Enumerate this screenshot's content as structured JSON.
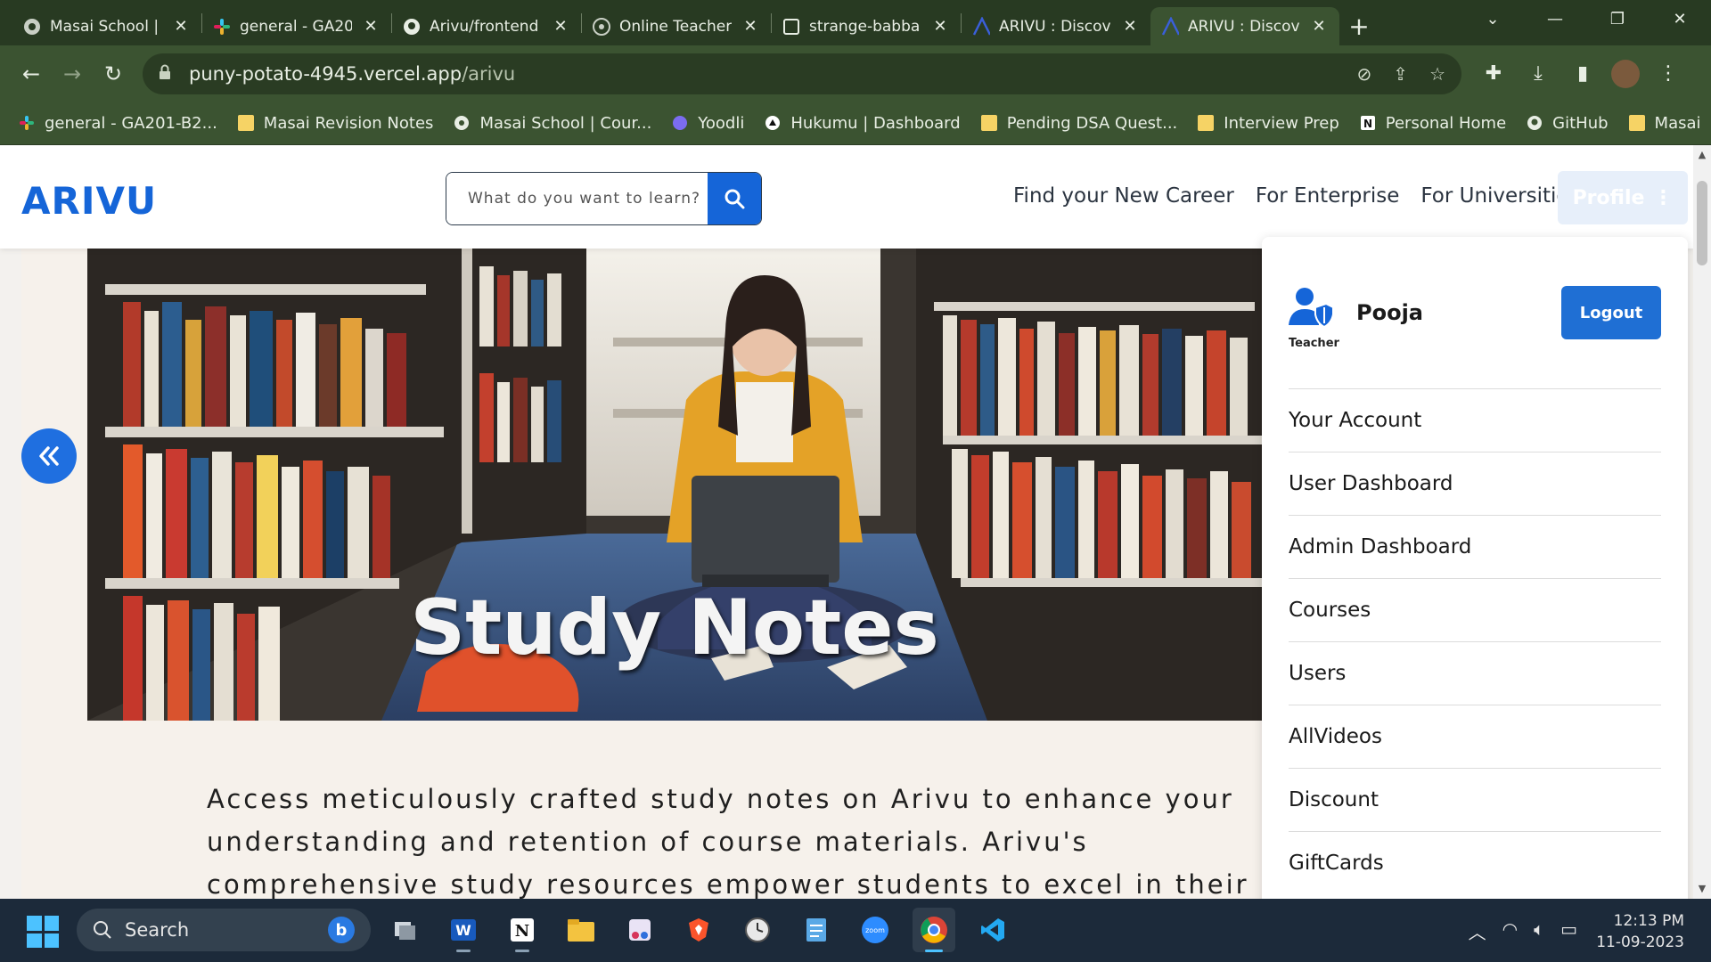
{
  "browser": {
    "tabs": [
      {
        "title": "Masai School |",
        "icon": "masai-icon",
        "active": false
      },
      {
        "title": "general - GA20",
        "icon": "slack-icon",
        "active": false
      },
      {
        "title": "Arivu/frontend",
        "icon": "github-icon",
        "active": false
      },
      {
        "title": "Online Teacher",
        "icon": "chatgpt-icon",
        "active": false
      },
      {
        "title": "strange-babba",
        "icon": "page-icon",
        "active": false
      },
      {
        "title": "ARIVU : Discov",
        "icon": "arivu-icon",
        "active": false
      },
      {
        "title": "ARIVU : Discov",
        "icon": "arivu-icon",
        "active": true
      }
    ],
    "url_host": "puny-potato-4945.vercel.app",
    "url_path": "/arivu",
    "bookmarks": [
      {
        "label": "general - GA201-B2...",
        "icon": "slack-icon"
      },
      {
        "label": "Masai Revision Notes",
        "icon": "folder-icon"
      },
      {
        "label": "Masai School | Cour...",
        "icon": "masai-icon"
      },
      {
        "label": "Yoodli",
        "icon": "yoodli-icon"
      },
      {
        "label": "Hukumu | Dashboard",
        "icon": "hukumu-icon"
      },
      {
        "label": "Pending DSA Quest...",
        "icon": "folder-icon"
      },
      {
        "label": "Interview Prep",
        "icon": "folder-icon"
      },
      {
        "label": "Personal Home",
        "icon": "notion-icon"
      },
      {
        "label": "GitHub",
        "icon": "github-icon"
      },
      {
        "label": "Masai",
        "icon": "folder-icon"
      }
    ],
    "bookmarks_more": "»"
  },
  "site": {
    "logo": "ARIVU",
    "search_placeholder": "What do you want to learn?",
    "nav": [
      "Find your New Career",
      "For Enterprise",
      "For Universities"
    ],
    "profile_label": "Profile"
  },
  "hero": {
    "title": "Study Notes"
  },
  "description": "Access meticulously crafted study notes on Arivu to enhance your understanding and retention of course materials. Arivu's comprehensive study resources empower students to excel in their studies and gain a deeper understanding of the",
  "dropdown": {
    "user_name": "Pooja",
    "role": "Teacher",
    "logout_label": "Logout",
    "items": [
      "Your Account",
      "User Dashboard",
      "Admin Dashboard",
      "Courses",
      "Users",
      "AllVideos",
      "Discount",
      "GiftCards"
    ]
  },
  "taskbar": {
    "search_label": "Search",
    "time": "12:13 PM",
    "date": "11-09-2023"
  },
  "colors": {
    "brand_blue": "#1565d8",
    "chrome_green": "#3b5331"
  }
}
